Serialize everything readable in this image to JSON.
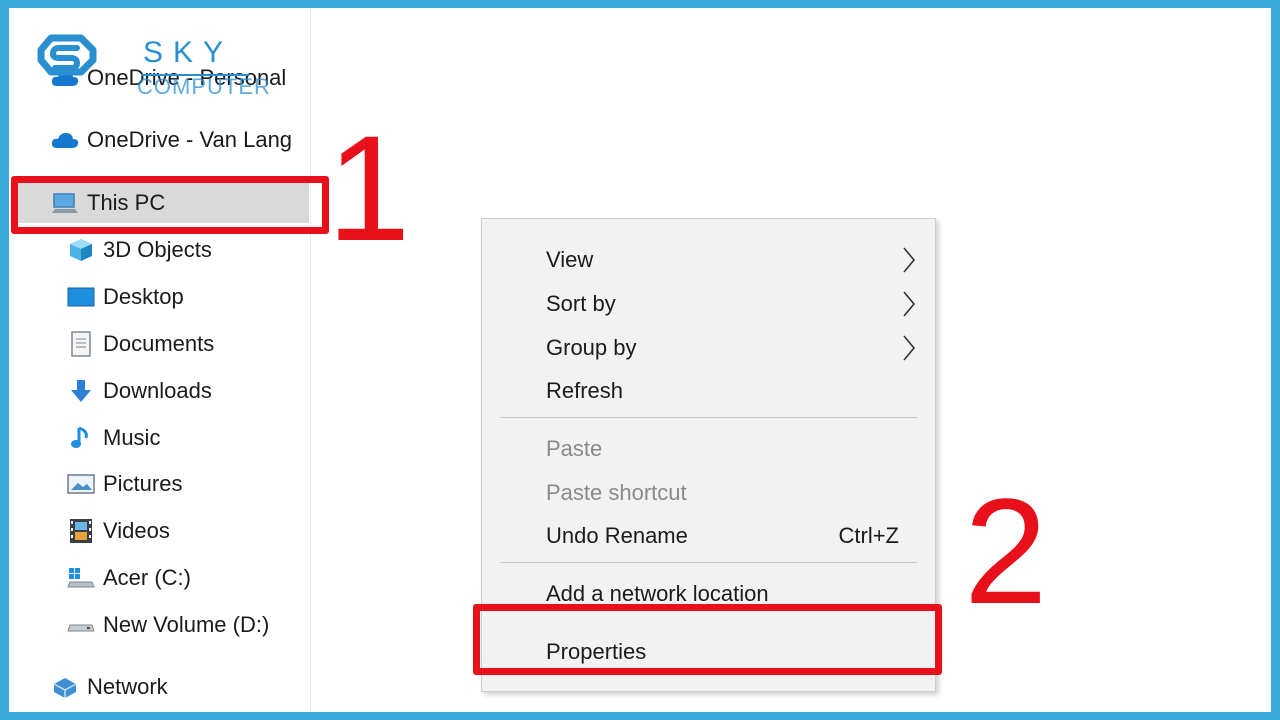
{
  "logo": {
    "brand": "SKY",
    "sub": "COMPUTER"
  },
  "sidebar": {
    "items": [
      {
        "label": "OneDrive - Personal",
        "icon": "onedrive-cloud-icon"
      },
      {
        "label": "OneDrive - Van Lang",
        "icon": "onedrive-cloud-icon"
      },
      {
        "label": "This PC",
        "icon": "computer-icon"
      },
      {
        "label": "3D Objects",
        "icon": "cube-icon"
      },
      {
        "label": "Desktop",
        "icon": "desktop-icon"
      },
      {
        "label": "Documents",
        "icon": "document-icon"
      },
      {
        "label": "Downloads",
        "icon": "download-arrow-icon"
      },
      {
        "label": "Music",
        "icon": "music-note-icon"
      },
      {
        "label": "Pictures",
        "icon": "pictures-icon"
      },
      {
        "label": "Videos",
        "icon": "film-strip-icon"
      },
      {
        "label": "Acer (C:)",
        "icon": "windows-drive-icon"
      },
      {
        "label": "New Volume (D:)",
        "icon": "drive-icon"
      },
      {
        "label": "Network",
        "icon": "network-icon"
      }
    ],
    "selected": "This PC"
  },
  "context_menu": {
    "items": [
      {
        "label": "View",
        "submenu": true,
        "enabled": true
      },
      {
        "label": "Sort by",
        "submenu": true,
        "enabled": true
      },
      {
        "label": "Group by",
        "submenu": true,
        "enabled": true
      },
      {
        "label": "Refresh",
        "enabled": true
      },
      {
        "label": "Paste",
        "enabled": false
      },
      {
        "label": "Paste shortcut",
        "enabled": false
      },
      {
        "label": "Undo Rename",
        "shortcut": "Ctrl+Z",
        "enabled": true
      },
      {
        "label": "Add a network location",
        "enabled": true
      },
      {
        "label": "Properties",
        "enabled": true
      }
    ]
  },
  "annotations": {
    "step1": "1",
    "step2": "2",
    "color": "#e8101a"
  }
}
